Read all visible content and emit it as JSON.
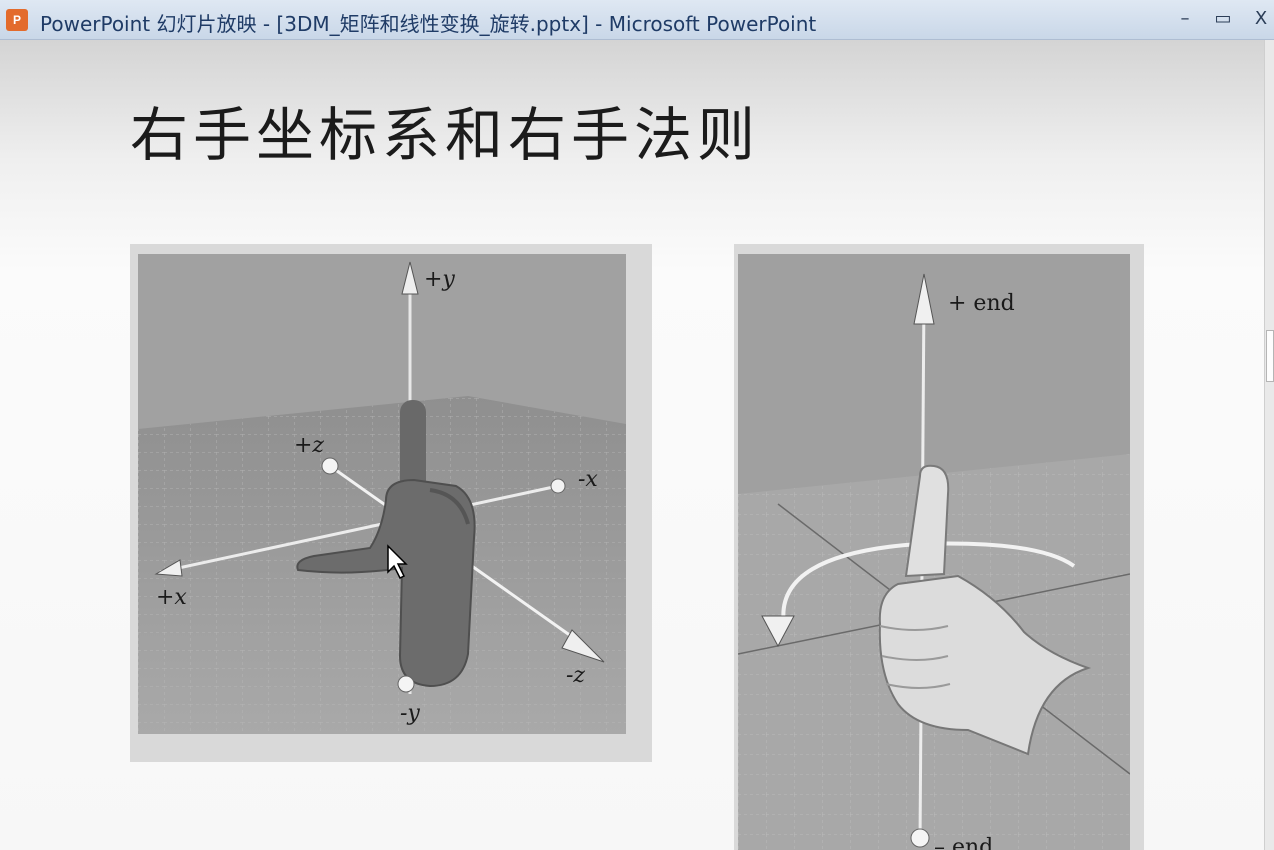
{
  "window": {
    "app_icon_text": "P",
    "title": "PowerPoint 幻灯片放映 - [3DM_矩阵和线性变换_旋转.pptx] - Microsoft PowerPoint",
    "controls": {
      "minimize": "–",
      "maximize": "▭",
      "close": "X"
    }
  },
  "slide": {
    "title": "右手坐标系和右手法则",
    "figure_left": {
      "labels": {
        "pos_y": "+y",
        "pos_z": "+z",
        "neg_x": "-x",
        "pos_x": "+x",
        "neg_z": "-z",
        "neg_y": "-y"
      }
    },
    "figure_right": {
      "labels": {
        "pos_end": "+ end",
        "neg_end": "– end"
      }
    }
  },
  "colors": {
    "titlebar_text": "#1f3b66",
    "app_icon": "#e36b2c",
    "figure_bg": "#9a9a9a"
  }
}
